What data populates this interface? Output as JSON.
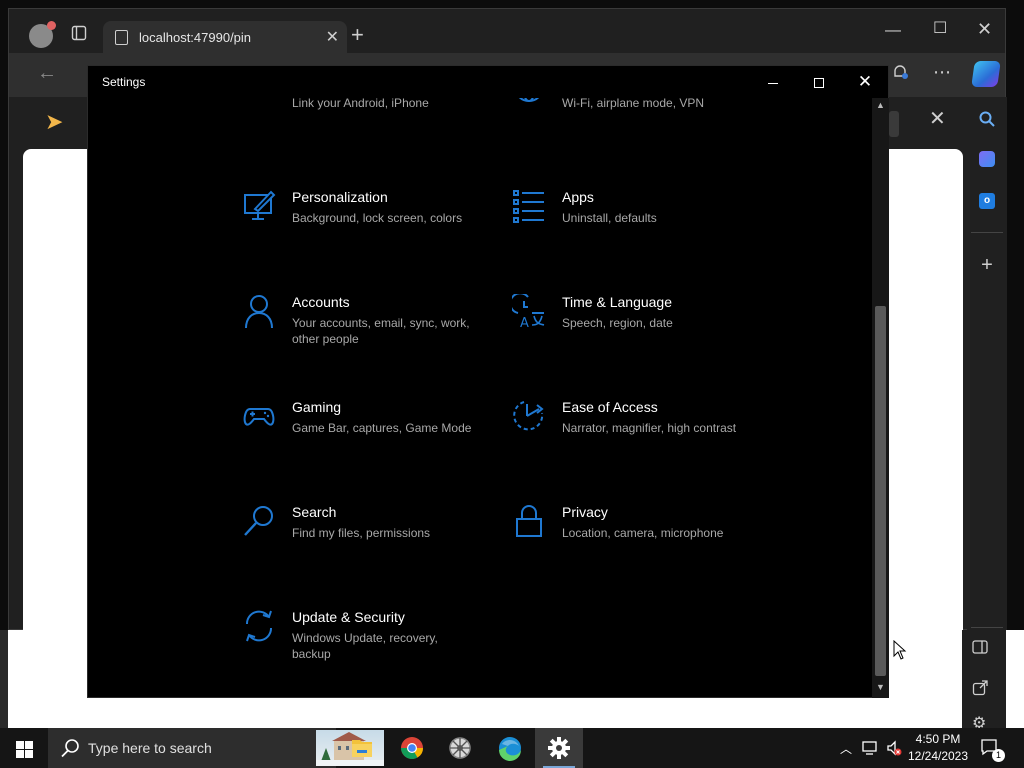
{
  "browser": {
    "tab_title": "localhost:47990/pin",
    "icons": [
      "profile-avatar",
      "tab-actions-icon",
      "new-tab-icon",
      "back-icon",
      "notifications-icon",
      "more-icon",
      "copilot-icon",
      "search-icon",
      "outlook-icon",
      "add-icon"
    ]
  },
  "settings": {
    "window_title": "Settings",
    "accent_color": "#1f78d1",
    "categories": [
      {
        "id": "phone",
        "title": "",
        "desc": "Link your Android, iPhone"
      },
      {
        "id": "network",
        "title": "",
        "desc": "Wi-Fi, airplane mode, VPN"
      },
      {
        "id": "personalization",
        "title": "Personalization",
        "desc": "Background, lock screen, colors"
      },
      {
        "id": "apps",
        "title": "Apps",
        "desc": "Uninstall, defaults"
      },
      {
        "id": "accounts",
        "title": "Accounts",
        "desc": "Your accounts, email, sync, work, other people"
      },
      {
        "id": "time-language",
        "title": "Time & Language",
        "desc": "Speech, region, date"
      },
      {
        "id": "gaming",
        "title": "Gaming",
        "desc": "Game Bar, captures, Game Mode"
      },
      {
        "id": "ease-of-access",
        "title": "Ease of Access",
        "desc": "Narrator, magnifier, high contrast"
      },
      {
        "id": "search",
        "title": "Search",
        "desc": "Find my files, permissions"
      },
      {
        "id": "privacy",
        "title": "Privacy",
        "desc": "Location, camera, microphone"
      },
      {
        "id": "update-security",
        "title": "Update & Security",
        "desc": "Windows Update, recovery, backup"
      }
    ]
  },
  "taskbar": {
    "search_placeholder": "Type here to search",
    "apps": [
      "file-explorer",
      "chrome",
      "app-wheel",
      "edge",
      "settings"
    ],
    "time": "4:50 PM",
    "date": "12/24/2023",
    "notification_count": "1"
  }
}
